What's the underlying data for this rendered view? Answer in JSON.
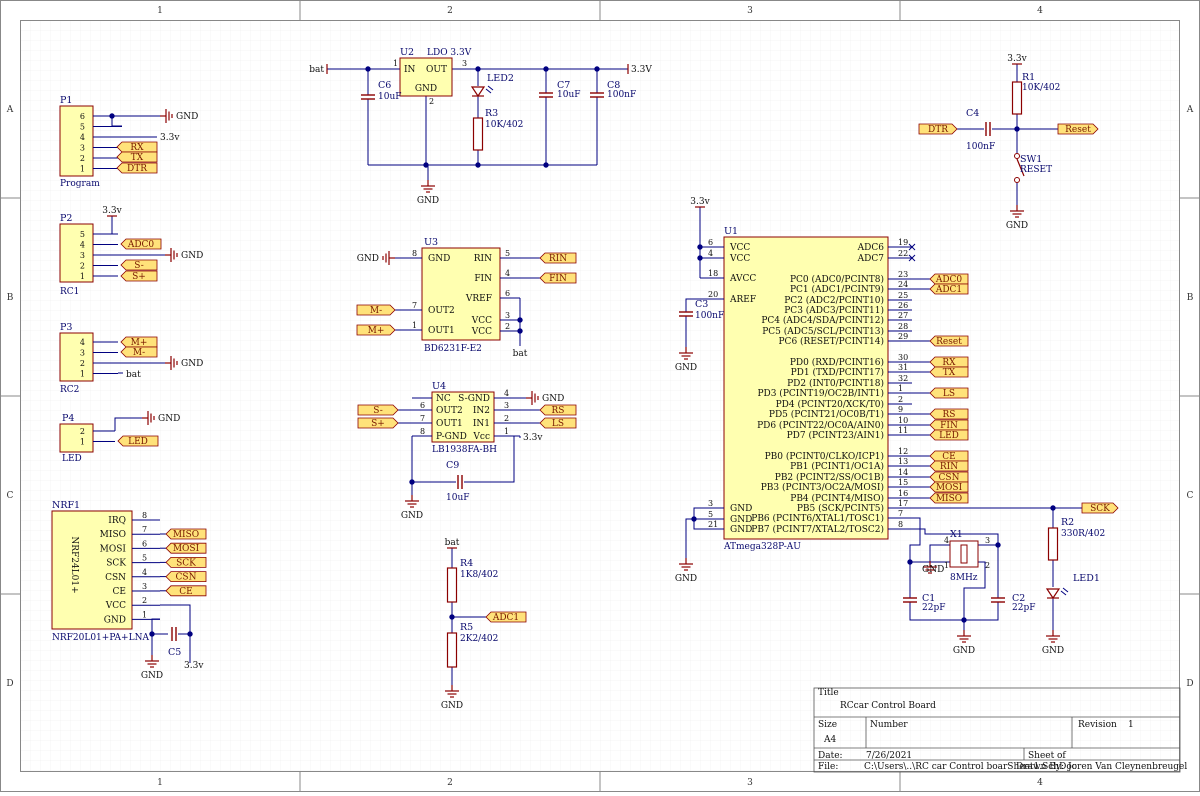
{
  "zones": {
    "cols": [
      "1",
      "2",
      "3",
      "4"
    ],
    "rows": [
      "A",
      "B",
      "C",
      "D"
    ]
  },
  "components": [
    {
      "id": "p1",
      "des": "P1",
      "val": "Program",
      "pins": [
        "6",
        "5",
        "4",
        "3",
        "2",
        "1"
      ]
    },
    {
      "id": "p2",
      "des": "P2",
      "val": "RC1",
      "pins": [
        "5",
        "4",
        "3",
        "2",
        "1"
      ]
    },
    {
      "id": "p3",
      "des": "P3",
      "val": "RC2",
      "pins": [
        "4",
        "3",
        "2",
        "1"
      ]
    },
    {
      "id": "p4",
      "des": "P4",
      "val": "LED",
      "pins": [
        "2",
        "1"
      ]
    },
    {
      "id": "nrf1",
      "des": "NRF1",
      "val": "NRF20L01+PA+LNA",
      "body": "NRF24L01+",
      "pins": [
        {
          "n": "8",
          "name": "IRQ"
        },
        {
          "n": "7",
          "name": "MISO"
        },
        {
          "n": "6",
          "name": "MOSI"
        },
        {
          "n": "5",
          "name": "SCK"
        },
        {
          "n": "4",
          "name": "CSN"
        },
        {
          "n": "3",
          "name": "CE"
        },
        {
          "n": "2",
          "name": "VCC"
        },
        {
          "n": "1",
          "name": "GND"
        }
      ]
    },
    {
      "id": "u2",
      "des": "U2",
      "val": "LDO 3.3V",
      "pins": [
        {
          "n": "1",
          "name": "IN"
        },
        {
          "n": "3",
          "name": "OUT"
        },
        {
          "n": "2",
          "name": "GND"
        }
      ]
    },
    {
      "id": "u3",
      "des": "U3",
      "val": "BD6231F-E2",
      "pins": [
        {
          "n": "8",
          "name": "GND"
        },
        {
          "n": "5",
          "name": "RIN"
        },
        {
          "n": "4",
          "name": "FIN"
        },
        {
          "n": "6",
          "name": "VREF"
        },
        {
          "n": "7",
          "name": "OUT2"
        },
        {
          "n": "1",
          "name": "OUT1"
        },
        {
          "n": "3",
          "name": "VCC"
        },
        {
          "n": "2",
          "name": "VCC"
        }
      ]
    },
    {
      "id": "u4",
      "des": "U4",
      "val": "LB1938FA-BH",
      "pins": [
        {
          "n": "",
          "name": "NC"
        },
        {
          "n": "6",
          "name": "OUT2"
        },
        {
          "n": "7",
          "name": "OUT1"
        },
        {
          "n": "8",
          "name": "P-GND"
        },
        {
          "n": "4",
          "name": "S-GND"
        },
        {
          "n": "3",
          "name": "IN2"
        },
        {
          "n": "2",
          "name": "IN1"
        },
        {
          "n": "1",
          "name": "Vcc"
        }
      ]
    },
    {
      "id": "u1",
      "des": "U1",
      "val": "ATmega328P-AU"
    },
    {
      "id": "c6",
      "des": "C6",
      "val": "10uF"
    },
    {
      "id": "c7",
      "des": "C7",
      "val": "10uF"
    },
    {
      "id": "c8",
      "des": "C8",
      "val": "100nF"
    },
    {
      "id": "c9",
      "des": "C9",
      "val": "10uF"
    },
    {
      "id": "c5",
      "des": "C5",
      "val": ""
    },
    {
      "id": "c3",
      "des": "C3",
      "val": "100nF"
    },
    {
      "id": "c4",
      "des": "C4",
      "val": "100nF"
    },
    {
      "id": "c1",
      "des": "C1",
      "val": "22pF"
    },
    {
      "id": "c2",
      "des": "C2",
      "val": "22pF"
    },
    {
      "id": "r1",
      "des": "R1",
      "val": "10K/402"
    },
    {
      "id": "r2",
      "des": "R2",
      "val": "330R/402"
    },
    {
      "id": "r3",
      "des": "R3",
      "val": "10K/402"
    },
    {
      "id": "r4",
      "des": "R4",
      "val": "1K8/402"
    },
    {
      "id": "r5",
      "des": "R5",
      "val": "2K2/402"
    },
    {
      "id": "led1",
      "des": "LED1",
      "val": ""
    },
    {
      "id": "led2",
      "des": "LED2",
      "val": ""
    },
    {
      "id": "x1",
      "des": "X1",
      "val": "8MHz",
      "pins": [
        "4",
        "3",
        "1",
        "2"
      ]
    },
    {
      "id": "sw1",
      "des": "SW1",
      "val": "RESET"
    }
  ],
  "u1_left": [
    {
      "n": "6",
      "name": "VCC"
    },
    {
      "n": "4",
      "name": "VCC"
    },
    {
      "n": "18",
      "name": "AVCC"
    },
    {
      "n": "20",
      "name": "AREF"
    },
    {
      "n": "3",
      "name": "GND"
    },
    {
      "n": "5",
      "name": "GND"
    },
    {
      "n": "21",
      "name": "GND"
    }
  ],
  "u1_right": [
    {
      "n": "19",
      "name": "ADC6"
    },
    {
      "n": "22",
      "name": "ADC7"
    },
    {
      "n": "23",
      "name": "PC0 (ADC0/PCINT8)"
    },
    {
      "n": "24",
      "name": "PC1 (ADC1/PCINT9)"
    },
    {
      "n": "25",
      "name": "PC2 (ADC2/PCINT10)"
    },
    {
      "n": "26",
      "name": "PC3 (ADC3/PCINT11)"
    },
    {
      "n": "27",
      "name": "PC4 (ADC4/SDA/PCINT12)"
    },
    {
      "n": "28",
      "name": "PC5 (ADC5/SCL/PCINT13)"
    },
    {
      "n": "29",
      "name": "PC6 (RESET/PCINT14)"
    },
    {
      "n": "30",
      "name": "PD0 (RXD/PCINT16)"
    },
    {
      "n": "31",
      "name": "PD1 (TXD/PCINT17)"
    },
    {
      "n": "32",
      "name": "PD2 (INT0/PCINT18)"
    },
    {
      "n": "1",
      "name": "PD3 (PCINT19/OC2B/INT1)"
    },
    {
      "n": "2",
      "name": "PD4 (PCINT20/XCK/T0)"
    },
    {
      "n": "9",
      "name": "PD5 (PCINT21/OC0B/T1)"
    },
    {
      "n": "10",
      "name": "PD6 (PCINT22/OC0A/AIN0)"
    },
    {
      "n": "11",
      "name": "PD7 (PCINT23/AIN1)"
    },
    {
      "n": "12",
      "name": "PB0 (PCINT0/CLKO/ICP1)"
    },
    {
      "n": "13",
      "name": "PB1 (PCINT1/OC1A)"
    },
    {
      "n": "14",
      "name": "PB2 (PCINT2/SS/OC1B)"
    },
    {
      "n": "15",
      "name": "PB3 (PCINT3/OC2A/MOSI)"
    },
    {
      "n": "16",
      "name": "PB4 (PCINT4/MISO)"
    },
    {
      "n": "17",
      "name": "PB5 (SCK/PCINT5)"
    },
    {
      "n": "7",
      "name": "PB6 (PCINT6/XTAL1/TOSC1)"
    },
    {
      "n": "8",
      "name": "PB7 (PCINT7/XTAL2/TOSC2)"
    }
  ],
  "nets": {
    "gnd": "GND",
    "v33": "3.3v",
    "v33b": "3.3V",
    "bat": "bat"
  },
  "netlabels": [
    "RX",
    "TX",
    "DTR",
    "ADC0",
    "S-",
    "S+",
    "M+",
    "M-",
    "LED",
    "MISO",
    "MOSI",
    "SCK",
    "CSN",
    "CE",
    "RIN",
    "FIN",
    "M-",
    "M+",
    "S-",
    "S+",
    "RS",
    "LS",
    "ADC1",
    "ADC0",
    "ADC1",
    "Reset",
    "RX",
    "TX",
    "LS",
    "RS",
    "FIN",
    "LED",
    "CE",
    "RIN",
    "CSN",
    "MOSI",
    "MISO",
    "SCK",
    "DTR",
    "Reset"
  ],
  "title_block": {
    "title_label": "Title",
    "title": "RCcar Control Board",
    "size_label": "Size",
    "size": "A4",
    "number_label": "Number",
    "revision_label": "Revision",
    "revision": "1",
    "date_label": "Date:",
    "date": "7/26/2021",
    "sheet_label": "Sheet",
    "sheet_of": "of",
    "file_label": "File:",
    "file": "C:\\Users\\..\\RC car Control boarSheet1.SchDoc",
    "drawn_label": "Drawn By:",
    "drawn": "Joren Van Cleynenbreugel"
  },
  "colors": {
    "wire": "#000080",
    "part": "#8b0000",
    "body": "#ffffb0",
    "border": "#888888",
    "netflag": "#ffe27a",
    "grid": "#e8e8e8"
  }
}
